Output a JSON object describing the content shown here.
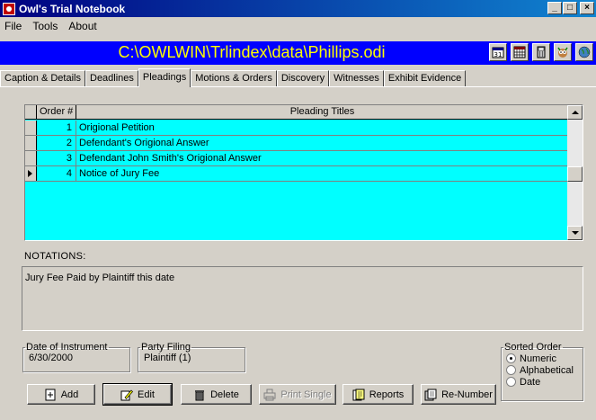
{
  "window": {
    "title": "Owl's Trial Notebook",
    "minimize": "_",
    "maximize": "□",
    "close": "×"
  },
  "menu": [
    "File",
    "Tools",
    "About"
  ],
  "path": "C:\\OWLWIN\\Trlindex\\data\\Phillips.odi",
  "toolbar_icons": [
    "calendar-icon",
    "calculator-grid-icon",
    "calculator-icon",
    "owl-icon",
    "globe-icon"
  ],
  "tabs": [
    "Caption & Details",
    "Deadlines",
    "Pleadings",
    "Motions & Orders",
    "Discovery",
    "Witnesses",
    "Exhibit Evidence"
  ],
  "active_tab": "Pleadings",
  "grid": {
    "headers": {
      "order": "Order #",
      "title": "Pleading Titles"
    },
    "rows": [
      {
        "order": "1",
        "title": "Origional Petition"
      },
      {
        "order": "2",
        "title": "Defendant's Origional Answer"
      },
      {
        "order": "3",
        "title": "Defendant John Smith's Origional Answer"
      },
      {
        "order": "4",
        "title": "Notice of Jury Fee"
      }
    ],
    "current_row": 4
  },
  "notations": {
    "label": "NOTATIONS:",
    "text": "Jury Fee Paid by Plaintiff this date"
  },
  "date_of_instrument": {
    "label": "Date of Instrument",
    "value": "6/30/2000"
  },
  "party_filing": {
    "label": "Party Filing",
    "value": "Plaintiff (1)"
  },
  "sorted_order": {
    "label": "Sorted Order",
    "options": [
      "Numeric",
      "Alphabetical",
      "Date"
    ],
    "selected": "Numeric"
  },
  "buttons": {
    "add": "Add",
    "edit": "Edit",
    "delete": "Delete",
    "print_single": "Print Single",
    "reports": "Reports",
    "renumber": "Re-Number"
  },
  "colors": {
    "title_bar": "#000080",
    "path_bar_bg": "#0000ff",
    "path_bar_text": "#ffff00",
    "grid_bg": "#00ffff",
    "window_bg": "#d4d0c8"
  }
}
